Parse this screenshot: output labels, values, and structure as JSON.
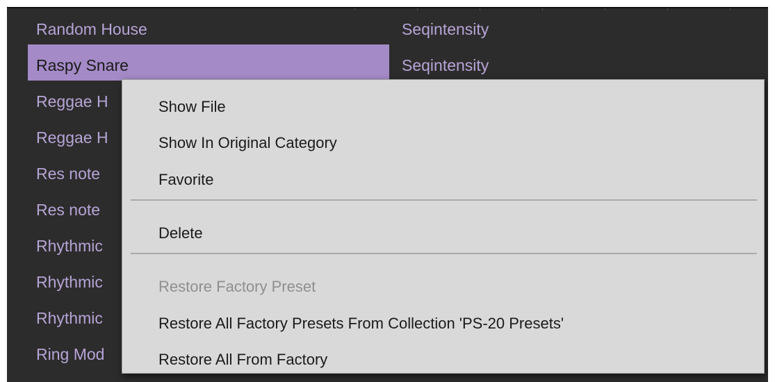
{
  "preset_list": {
    "items": [
      {
        "label": "Random House",
        "selected": false
      },
      {
        "label": "Raspy Snare",
        "selected": true
      },
      {
        "label": "Reggae H",
        "selected": false
      },
      {
        "label": "Reggae H",
        "selected": false
      },
      {
        "label": "Res note",
        "selected": false
      },
      {
        "label": "Res note",
        "selected": false
      },
      {
        "label": "Rhythmic",
        "selected": false
      },
      {
        "label": "Rhythmic",
        "selected": false
      },
      {
        "label": "Rhythmic",
        "selected": false
      },
      {
        "label": "Ring Mod",
        "selected": false
      }
    ]
  },
  "category_list": {
    "items": [
      {
        "label": "Seqintensity"
      },
      {
        "label": "Seqintensity"
      }
    ]
  },
  "context_menu": {
    "items": [
      {
        "label": "Show File",
        "enabled": true
      },
      {
        "label": "Show In Original Category",
        "enabled": true
      },
      {
        "label": "Favorite",
        "enabled": true
      },
      {
        "label": "Delete",
        "enabled": true
      },
      {
        "label": "Restore Factory Preset",
        "enabled": false
      },
      {
        "label": "Restore All Factory Presets From Collection 'PS-20 Presets'",
        "enabled": true
      },
      {
        "label": "Restore All From Factory",
        "enabled": true
      }
    ]
  },
  "colors": {
    "background": "#2c2c2c",
    "list_text": "#b7a4d6",
    "selection": "#a48ac6",
    "menu_background": "#d9d9d9",
    "disabled_text": "#8f8f8f"
  }
}
